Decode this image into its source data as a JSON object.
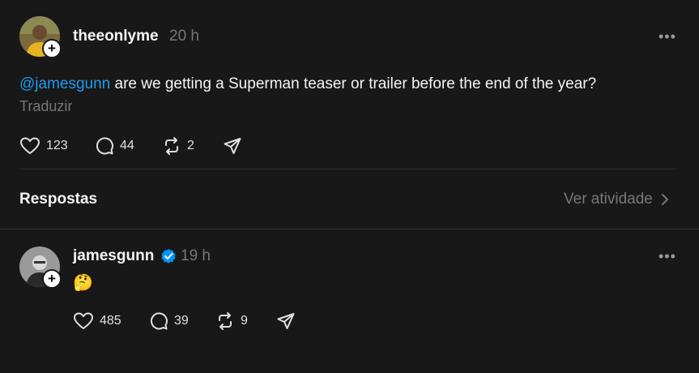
{
  "post": {
    "username": "theeonlyme",
    "time": "20 h",
    "mention": "@jamesgunn",
    "text": " are we getting a Superman teaser or trailer before the end of the year?",
    "translate_label": "Traduzir",
    "likes": "123",
    "replies": "44",
    "reposts": "2",
    "more_label": "•••"
  },
  "responses_header": {
    "title": "Respostas",
    "activity_label": "Ver atividade"
  },
  "reply": {
    "username": "jamesgunn",
    "time": "19 h",
    "text": "🤔",
    "likes": "485",
    "replies": "39",
    "reposts": "9",
    "more_label": "•••",
    "verified": true
  },
  "colors": {
    "background": "#181818",
    "mention": "#1d9bf0",
    "verified": "#0095f6",
    "muted": "#777777"
  }
}
